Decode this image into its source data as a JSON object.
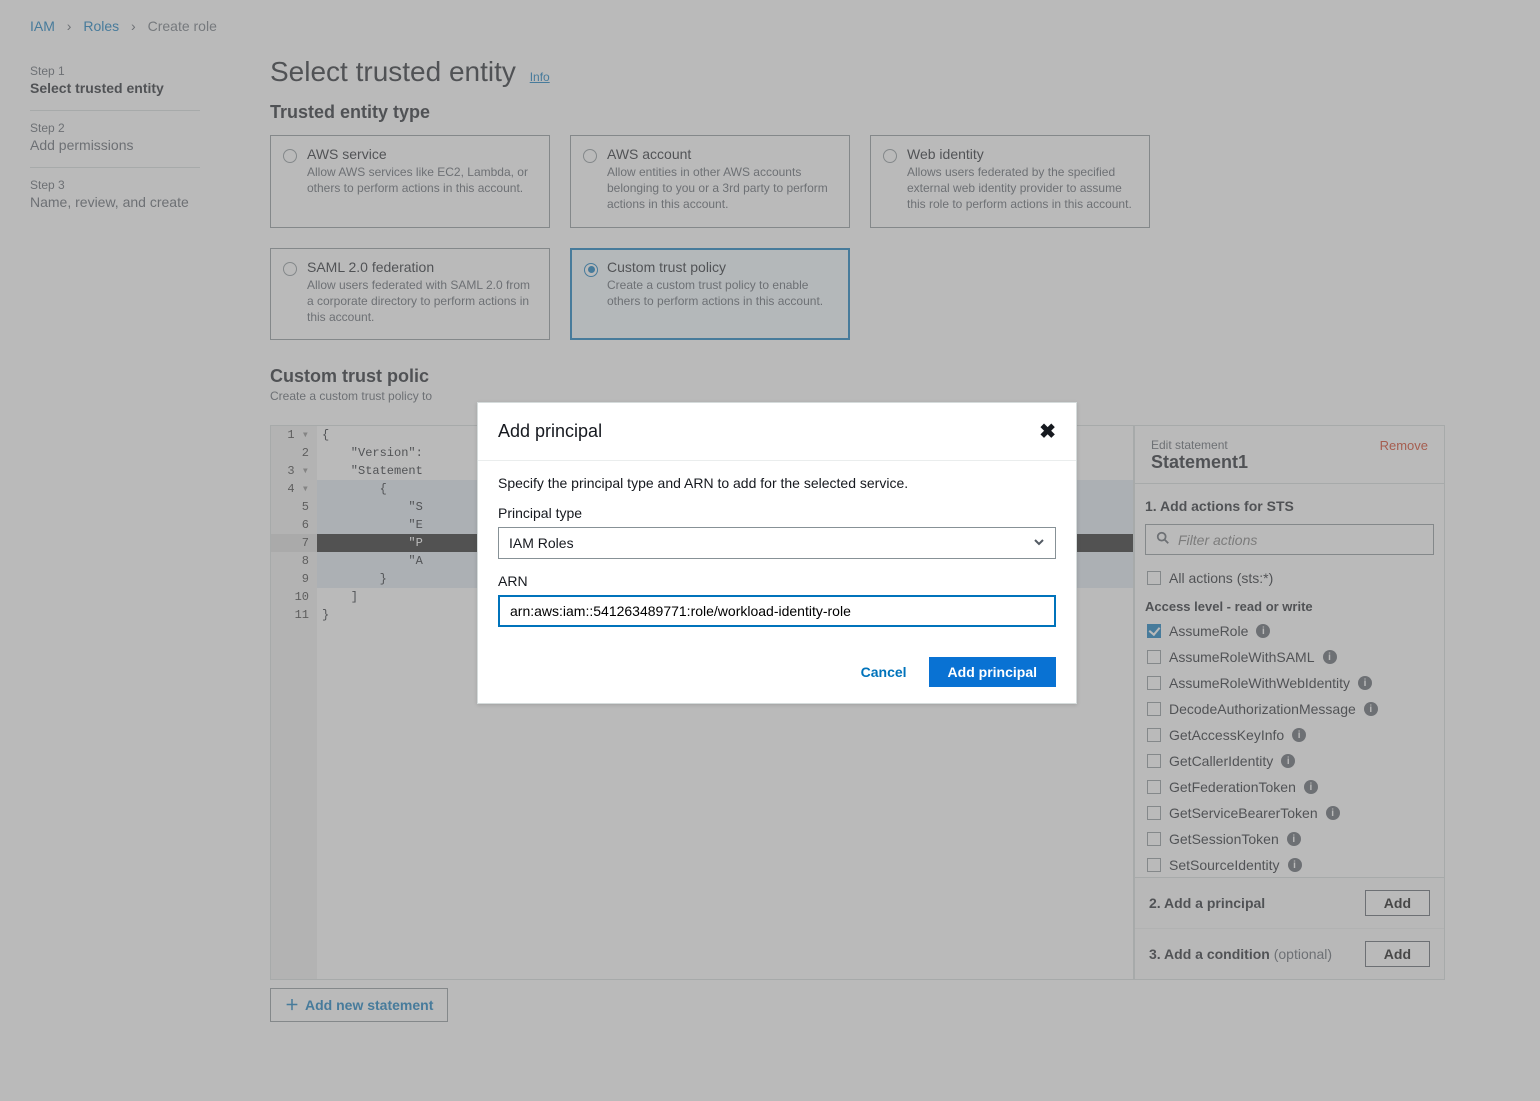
{
  "breadcrumb": {
    "iam": "IAM",
    "roles": "Roles",
    "current": "Create role"
  },
  "steps": {
    "s1n": "Step 1",
    "s1t": "Select trusted entity",
    "s2n": "Step 2",
    "s2t": "Add permissions",
    "s3n": "Step 3",
    "s3t": "Name, review, and create"
  },
  "page": {
    "title": "Select trusted entity",
    "info": "Info",
    "entity_heading": "Trusted entity type"
  },
  "cards": {
    "aws_service": {
      "t": "AWS service",
      "d": "Allow AWS services like EC2, Lambda, or others to perform actions in this account."
    },
    "aws_account": {
      "t": "AWS account",
      "d": "Allow entities in other AWS accounts belonging to you or a 3rd party to perform actions in this account."
    },
    "web_identity": {
      "t": "Web identity",
      "d": "Allows users federated by the specified external web identity provider to assume this role to perform actions in this account."
    },
    "saml": {
      "t": "SAML 2.0 federation",
      "d": "Allow users federated with SAML 2.0 from a corporate directory to perform actions in this account."
    },
    "custom": {
      "t": "Custom trust policy",
      "d": "Create a custom trust policy to enable others to perform actions in this account."
    }
  },
  "custom_section": {
    "title": "Custom trust polic",
    "desc_trunc": "Create a custom trust policy to"
  },
  "code": {
    "l1": "{",
    "l2": "    \"Version\":",
    "l3": "    \"Statement",
    "l4": "        {",
    "l5": "            \"S",
    "l6": "            \"E",
    "l7": "            \"P",
    "l8": "            \"A",
    "l9": "        }",
    "l10": "    ]",
    "l11": "}"
  },
  "sidepanel": {
    "edit": "Edit statement",
    "name": "Statement1",
    "remove": "Remove",
    "actions_t": "1. Add actions for STS",
    "filter_ph": "Filter actions",
    "all_actions": "All actions (sts:*)",
    "level": "Access level - read or write",
    "actions": [
      "AssumeRole",
      "AssumeRoleWithSAML",
      "AssumeRoleWithWebIdentity",
      "DecodeAuthorizationMessage",
      "GetAccessKeyInfo",
      "GetCallerIdentity",
      "GetFederationToken",
      "GetServiceBearerToken",
      "GetSessionToken",
      "SetSourceIdentity"
    ],
    "principal_t": "2. Add a principal",
    "condition_t_pre": "3. Add a condition ",
    "condition_t_opt": "(optional)",
    "add": "Add"
  },
  "addstmt": "Add new statement",
  "modal": {
    "title": "Add principal",
    "desc": "Specify the principal type and ARN to add for the selected service.",
    "ptype_label": "Principal type",
    "ptype_value": "IAM Roles",
    "arn_label": "ARN",
    "arn_value": "arn:aws:iam::541263489771:role/workload-identity-role",
    "cancel": "Cancel",
    "submit": "Add principal"
  }
}
